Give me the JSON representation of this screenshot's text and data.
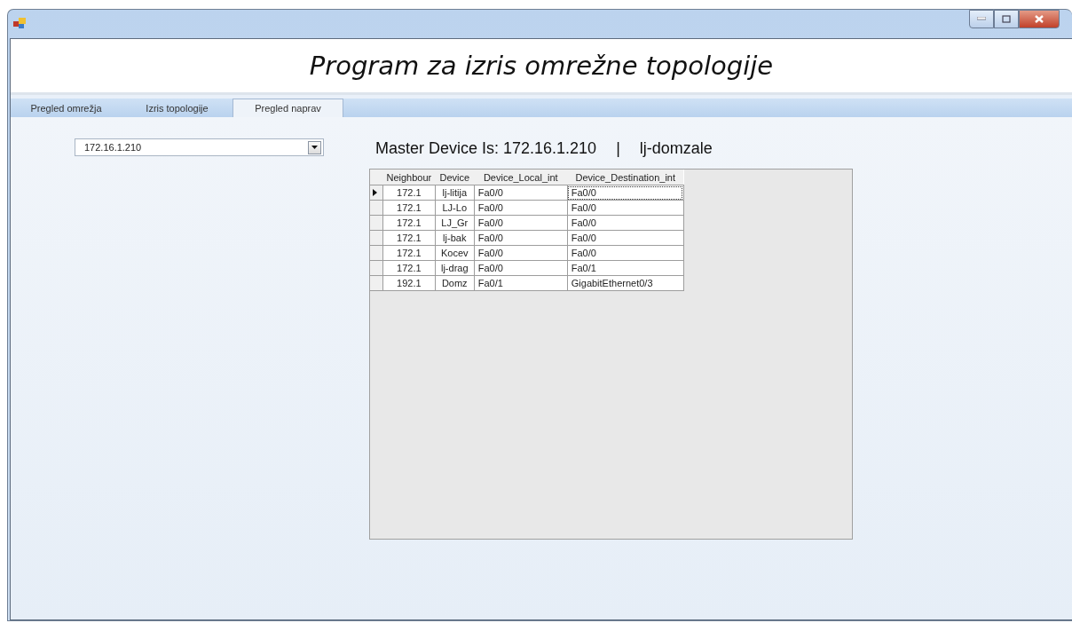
{
  "header": {
    "title": "Program za izris omrežne topologije"
  },
  "tabs": [
    {
      "label": "Pregled omrežja",
      "selected": false
    },
    {
      "label": "Izris topologije",
      "selected": false
    },
    {
      "label": "Pregled naprav",
      "selected": true
    }
  ],
  "device_combo": {
    "value": "172.16.1.210"
  },
  "master": {
    "label": "Master Device Is: 172.16.1.210",
    "separator": "|",
    "hostname": "lj-domzale"
  },
  "table": {
    "columns": [
      "Neighbour",
      "Device",
      "Device_Local_int",
      "Device_Destination_int"
    ],
    "rows": [
      {
        "cells": [
          "172.1",
          "lj-litija",
          "Fa0/0",
          "Fa0/0"
        ],
        "selected": true
      },
      {
        "cells": [
          "172.1",
          "LJ-Lo",
          "Fa0/0",
          "Fa0/0"
        ],
        "selected": false
      },
      {
        "cells": [
          "172.1",
          "LJ_Gr",
          "Fa0/0",
          "Fa0/0"
        ],
        "selected": false
      },
      {
        "cells": [
          "172.1",
          "lj-bak",
          "Fa0/0",
          "Fa0/0"
        ],
        "selected": false
      },
      {
        "cells": [
          "172.1",
          "Kocev",
          "Fa0/0",
          "Fa0/0"
        ],
        "selected": false
      },
      {
        "cells": [
          "172.1",
          "lj-drag",
          "Fa0/0",
          "Fa0/1"
        ],
        "selected": false
      },
      {
        "cells": [
          "192.1",
          "Domz",
          "Fa0/1",
          "GigabitEthernet0/3"
        ],
        "selected": false
      }
    ]
  }
}
